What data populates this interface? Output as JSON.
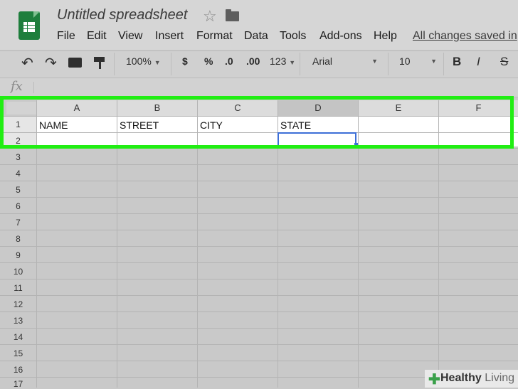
{
  "app": {
    "title": "Untitled spreadsheet",
    "icons": [
      "sheets-logo-icon",
      "star-icon",
      "folder-icon"
    ]
  },
  "menu": [
    "File",
    "Edit",
    "View",
    "Insert",
    "Format",
    "Data",
    "Tools",
    "Add-ons",
    "Help"
  ],
  "save_status": "All changes saved in",
  "toolbar": {
    "zoom": "100%",
    "currency": "$",
    "percent": "%",
    "decrease_decimals": ".0",
    "increase_decimals": ".00",
    "more_formats": "123",
    "font": "Arial",
    "font_size": "10",
    "bold": "B",
    "italic": "I",
    "strikethrough": "S"
  },
  "formula_bar": {
    "fx": "fx",
    "value": ""
  },
  "columns": [
    "A",
    "B",
    "C",
    "D",
    "E",
    "F"
  ],
  "rows": [
    "1",
    "2",
    "3",
    "4",
    "5",
    "6",
    "7",
    "8",
    "9",
    "10",
    "11",
    "12",
    "13",
    "14",
    "15",
    "16",
    "17"
  ],
  "cells": {
    "A1": "NAME",
    "B1": "STREET",
    "C1": "CITY",
    "D1": "STATE"
  },
  "selected_cell": "D2",
  "colors": {
    "highlight": "#21ee13",
    "selection": "#3d6fd7",
    "logo": "#1e7e3c"
  },
  "watermark": {
    "brand": "Healthy",
    "suffix": "Living"
  }
}
